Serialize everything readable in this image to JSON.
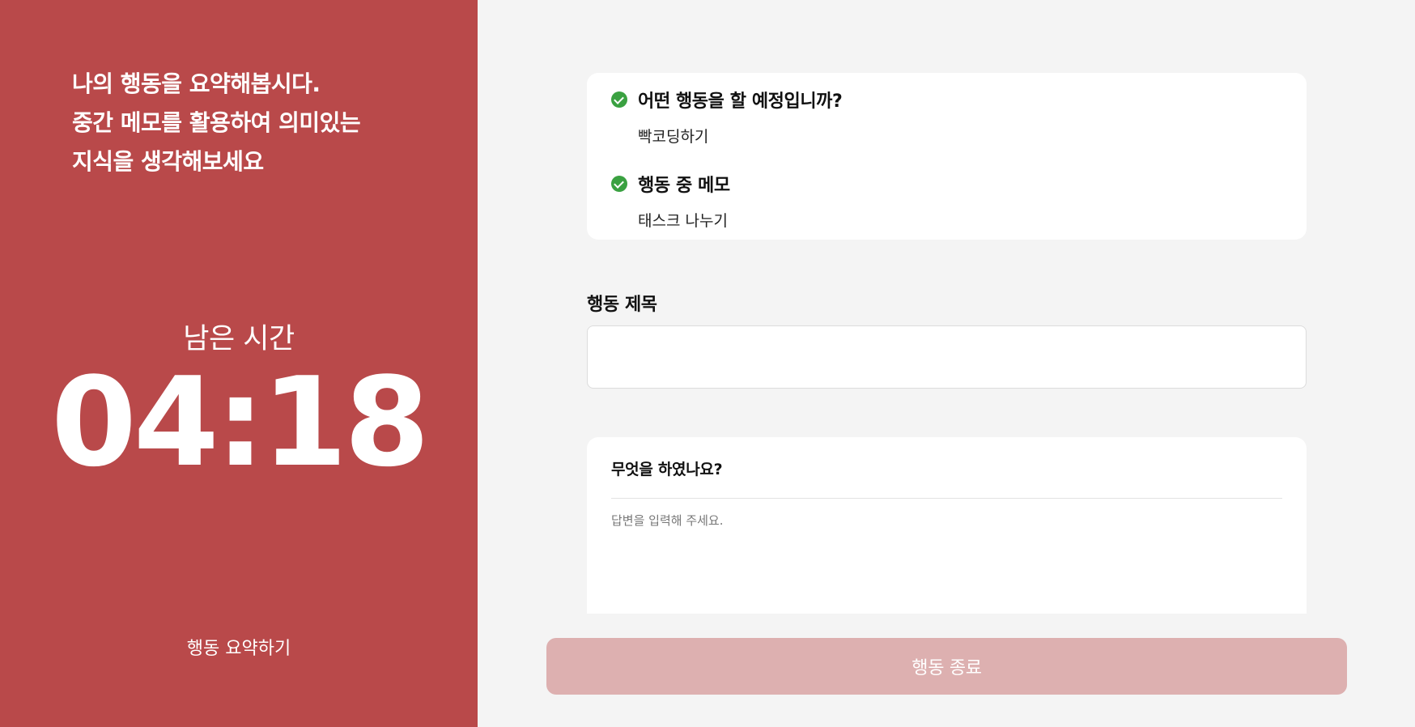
{
  "left": {
    "intro_lines": [
      "나의 행동을 요약해봅시다.",
      "중간 메모를 활용하여 의미있는",
      "지식을 생각해보세요"
    ],
    "timer_label": "남은 시간",
    "timer_value": "04:18",
    "summary_link": "행동 요약하기"
  },
  "plan": {
    "items": [
      {
        "question": "어떤 행동을 할 예정입니까?",
        "answer": "빡코딩하기",
        "icon": "check-circle-icon"
      },
      {
        "question": "행동 중 메모",
        "answer": "태스크 나누기",
        "icon": "check-circle-icon"
      }
    ]
  },
  "title_field": {
    "label": "행동 제목",
    "value": "",
    "placeholder": ""
  },
  "answer": {
    "question": "무엇을 하였나요?",
    "value": "",
    "placeholder": "답변을 입력해 주세요."
  },
  "end_button": {
    "label": "행동 종료"
  },
  "colors": {
    "left_panel": "#b9494a",
    "check": "#3aa141",
    "button_disabled": "#ddb0b0",
    "background": "#f4f4f4"
  }
}
